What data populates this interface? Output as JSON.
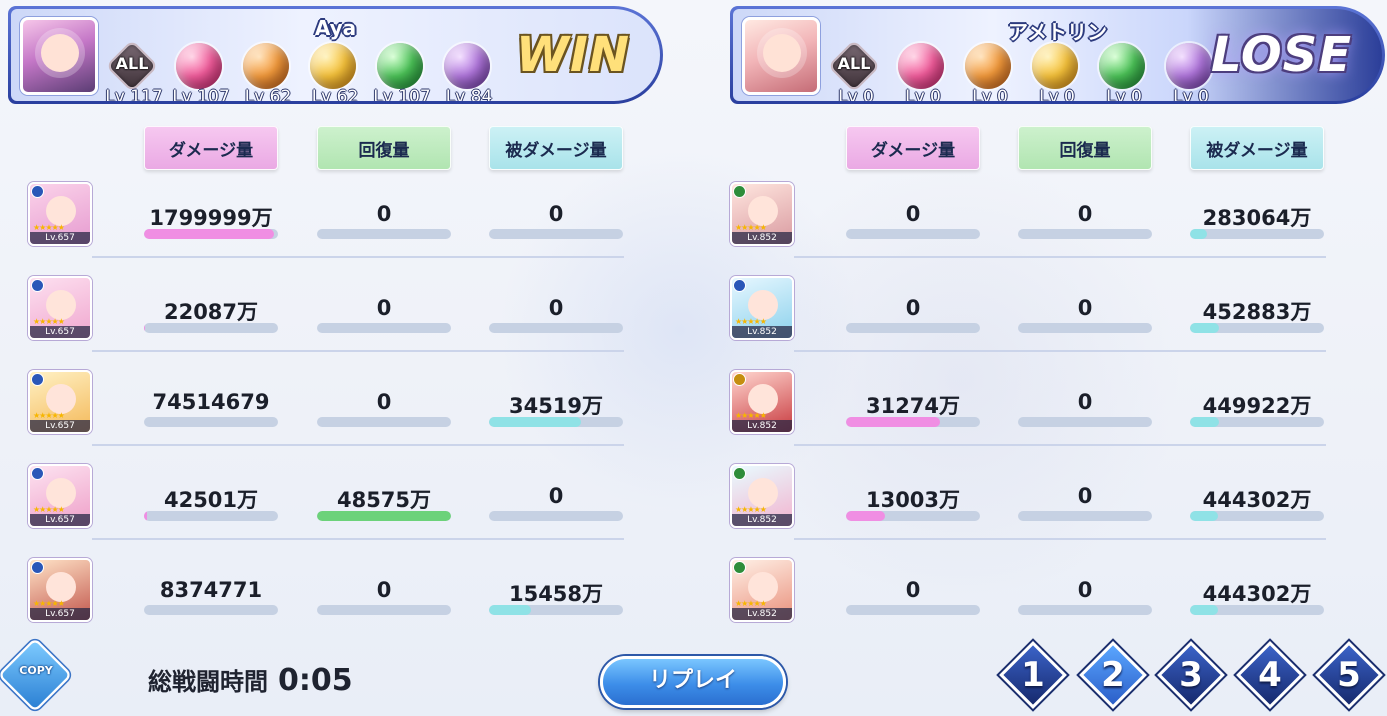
{
  "left_team": {
    "player_name": "Aya",
    "result": "WIN",
    "orbs": [
      {
        "icon": "all-element-icon",
        "label": "ALL",
        "level": "Lv 117"
      },
      {
        "icon": "fire-orb-icon",
        "level": "Lv 107"
      },
      {
        "icon": "shield-orb-icon",
        "level": "Lv 62"
      },
      {
        "icon": "thunder-orb-icon",
        "level": "Lv 62"
      },
      {
        "icon": "wind-orb-icon",
        "level": "Lv 107"
      },
      {
        "icon": "book-orb-icon",
        "level": "Lv 84"
      }
    ],
    "headers": {
      "damage": "ダメージ量",
      "heal": "回復量",
      "taken": "被ダメージ量"
    },
    "rows": [
      {
        "lv": "Lv.657",
        "damage": "1799999万",
        "heal": "0",
        "taken": "0",
        "damage_fill": 0.97,
        "heal_fill": 0,
        "taken_fill": 0
      },
      {
        "lv": "Lv.657",
        "damage": "22087万",
        "heal": "0",
        "taken": "0",
        "damage_fill": 0.01,
        "heal_fill": 0,
        "taken_fill": 0
      },
      {
        "lv": "Lv.657",
        "damage": "74514679",
        "heal": "0",
        "taken": "34519万",
        "damage_fill": 0,
        "heal_fill": 0,
        "taken_fill": 0.69
      },
      {
        "lv": "Lv.657",
        "damage": "42501万",
        "heal": "48575万",
        "taken": "0",
        "damage_fill": 0.02,
        "heal_fill": 1.0,
        "taken_fill": 0
      },
      {
        "lv": "Lv.657",
        "damage": "8374771",
        "heal": "0",
        "taken": "15458万",
        "damage_fill": 0,
        "heal_fill": 0,
        "taken_fill": 0.31
      }
    ]
  },
  "right_team": {
    "player_name": "アメトリン",
    "result": "LOSE",
    "orbs": [
      {
        "icon": "all-element-icon",
        "label": "ALL",
        "level": "Lv 0"
      },
      {
        "icon": "fire-orb-icon",
        "level": "Lv 0"
      },
      {
        "icon": "shield-orb-icon",
        "level": "Lv 0"
      },
      {
        "icon": "thunder-orb-icon",
        "level": "Lv 0"
      },
      {
        "icon": "wind-orb-icon",
        "level": "Lv 0"
      },
      {
        "icon": "book-orb-icon",
        "level": "Lv 0"
      }
    ],
    "headers": {
      "damage": "ダメージ量",
      "heal": "回復量",
      "taken": "被ダメージ量"
    },
    "rows": [
      {
        "lv": "Lv.852",
        "damage": "0",
        "heal": "0",
        "taken": "283064万",
        "damage_fill": 0,
        "heal_fill": 0,
        "taken_fill": 0.13
      },
      {
        "lv": "Lv.852",
        "damage": "0",
        "heal": "0",
        "taken": "452883万",
        "damage_fill": 0,
        "heal_fill": 0,
        "taken_fill": 0.22
      },
      {
        "lv": "Lv.852",
        "damage": "31274万",
        "heal": "0",
        "taken": "449922万",
        "damage_fill": 0.7,
        "heal_fill": 0,
        "taken_fill": 0.22
      },
      {
        "lv": "Lv.852",
        "damage": "13003万",
        "heal": "0",
        "taken": "444302万",
        "damage_fill": 0.29,
        "heal_fill": 0,
        "taken_fill": 0.21
      },
      {
        "lv": "Lv.852",
        "damage": "0",
        "heal": "0",
        "taken": "444302万",
        "damage_fill": 0,
        "heal_fill": 0,
        "taken_fill": 0.21
      }
    ]
  },
  "footer": {
    "copy_label": "COPY",
    "battle_time_label": "総戦闘時間",
    "battle_time_value": "0:05",
    "replay_label": "リプレイ",
    "pages": [
      "1",
      "2",
      "3",
      "4",
      "5"
    ],
    "active_page": "2"
  },
  "colors": {
    "damage": "#f08ee3",
    "heal": "#6cd27a",
    "taken": "#8fe2e6",
    "win": "#ffe07a"
  }
}
